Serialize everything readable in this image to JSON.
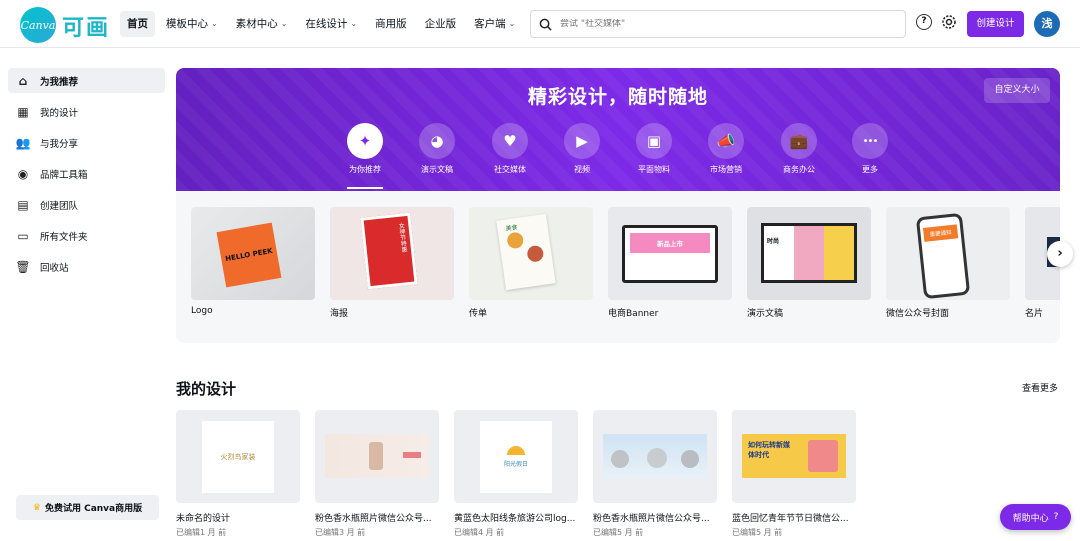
{
  "brand": {
    "logo_text": "Canva",
    "name_cn": "可画"
  },
  "nav": [
    {
      "label": "首页",
      "active": true,
      "dropdown": false
    },
    {
      "label": "模板中心",
      "dropdown": true
    },
    {
      "label": "素材中心",
      "dropdown": true
    },
    {
      "label": "在线设计",
      "dropdown": true
    },
    {
      "label": "商用版",
      "dropdown": false
    },
    {
      "label": "企业版",
      "dropdown": false
    },
    {
      "label": "客户端",
      "dropdown": true
    }
  ],
  "search": {
    "placeholder": "尝试 \"社交媒体\""
  },
  "header": {
    "help_icon": "?",
    "create_label": "创建设计",
    "avatar_initial": "浅"
  },
  "sidebar": {
    "items": [
      {
        "label": "为我推荐",
        "icon": "home-icon",
        "glyph": "⌂",
        "active": true
      },
      {
        "label": "我的设计",
        "icon": "grid-icon",
        "glyph": "▦"
      },
      {
        "label": "与我分享",
        "icon": "people-icon",
        "glyph": "👥"
      },
      {
        "label": "品牌工具箱",
        "icon": "brand-kit-icon",
        "glyph": "◉"
      },
      {
        "label": "创建团队",
        "icon": "team-icon",
        "glyph": "▤"
      },
      {
        "label": "所有文件夹",
        "icon": "folder-icon",
        "glyph": "▭"
      },
      {
        "label": "回收站",
        "icon": "trash-icon",
        "glyph": "🗑"
      }
    ],
    "trial": {
      "label": "免费试用 Canva商用版",
      "icon": "crown-icon",
      "glyph": "♛"
    }
  },
  "banner": {
    "title": "精彩设计，随时随地",
    "custom_size_label": "自定义大小",
    "categories": [
      {
        "label": "为你推荐",
        "icon": "sparkle-icon",
        "glyph": "✦",
        "active": true
      },
      {
        "label": "演示文稿",
        "icon": "presentation-icon",
        "glyph": "◕"
      },
      {
        "label": "社交媒体",
        "icon": "heart-icon",
        "glyph": "♥"
      },
      {
        "label": "视频",
        "icon": "video-icon",
        "glyph": "▶"
      },
      {
        "label": "平面物料",
        "icon": "print-icon",
        "glyph": "▣"
      },
      {
        "label": "市场营销",
        "icon": "megaphone-icon",
        "glyph": "📣"
      },
      {
        "label": "商务办公",
        "icon": "briefcase-icon",
        "glyph": "💼"
      },
      {
        "label": "更多",
        "icon": "more-icon",
        "glyph": "•••"
      }
    ]
  },
  "templates": [
    {
      "label": "Logo",
      "thumb_text": "HELLO PEEK"
    },
    {
      "label": "海报",
      "thumb_text": "女神节特惠"
    },
    {
      "label": "传单",
      "thumb_text": "美食"
    },
    {
      "label": "电商Banner",
      "thumb_text": "新品上市"
    },
    {
      "label": "演示文稿",
      "thumb_text": "时尚"
    },
    {
      "label": "微信公众号封面",
      "thumb_text": "重要通知"
    },
    {
      "label": "名片",
      "thumb_text": ""
    }
  ],
  "my_designs": {
    "title": "我的设计",
    "see_more": "查看更多",
    "items": [
      {
        "name": "未命名的设计",
        "edited": "已编辑1 月 前",
        "thumb_text": "火烈鸟家装"
      },
      {
        "name": "粉色香水瓶照片微信公众号...",
        "edited": "已编辑3 月 前",
        "thumb_text": ""
      },
      {
        "name": "黄蓝色太阳线条旅游公司log...",
        "edited": "已编辑4 月 前",
        "thumb_text": "阳光假日"
      },
      {
        "name": "粉色香水瓶照片微信公众号...",
        "edited": "已编辑5 月 前",
        "thumb_text": ""
      },
      {
        "name": "蓝色回忆青年节节日微信公...",
        "edited": "已编辑5 月 前",
        "thumb_text": "如何玩转新媒体时代"
      }
    ]
  },
  "help": {
    "label": "帮助中心",
    "icon": "?"
  },
  "colors": {
    "accent": "#7d2ae8",
    "brand_teal": "#00c4cc",
    "avatar": "#1d6ab5"
  }
}
